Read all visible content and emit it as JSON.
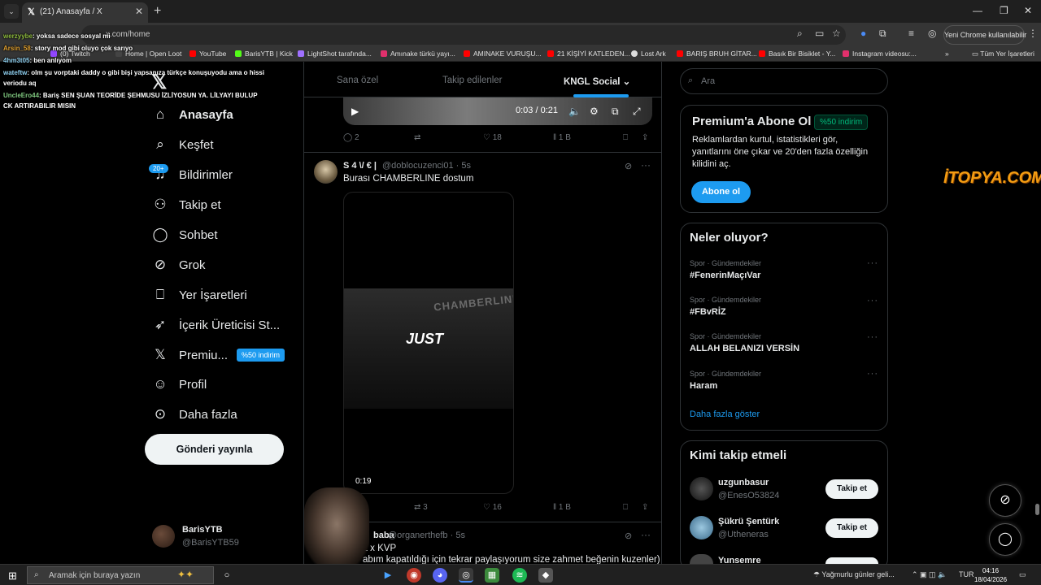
{
  "browser": {
    "tab_title": "(21) Anasayfa / X",
    "url": "x.com/home",
    "chrome_button": "Yeni Chrome kullanılabilir",
    "bookmarks": [
      {
        "label": "(0) Twitch",
        "color": "#9146ff"
      },
      {
        "label": "Home | Open Loot",
        "color": "#444444"
      },
      {
        "label": "YouTube",
        "color": "#ff0000"
      },
      {
        "label": "BarisYTB | Kick",
        "color": "#53fc18"
      },
      {
        "label": "LightShot tarafında...",
        "color": "#a070ff"
      },
      {
        "label": "Amınake türkü yayı...",
        "color": "#e1306c"
      },
      {
        "label": "AMINAKE VURUŞU...",
        "color": "#ff0000"
      },
      {
        "label": "21 KİŞİYİ KATLEDEN...",
        "color": "#ff0000"
      },
      {
        "label": "Lost Ark",
        "color": "#dddddd"
      },
      {
        "label": "BARIŞ BRUH GİTAR...",
        "color": "#ff0000"
      },
      {
        "label": "Basık Bir Bisiklet - Y...",
        "color": "#ff0000"
      },
      {
        "label": "Instagram videosu:...",
        "color": "#e1306c"
      }
    ],
    "all_bookmarks": "Tüm Yer İşaretleri"
  },
  "chat_overlay": [
    {
      "user": "werzyybe",
      "text": ": yoksa sadece sosyal mi"
    },
    {
      "user": "Arsin_58",
      "text": ": story mod gibi oluyo çok sarıyo"
    },
    {
      "user": "4hm3t05",
      "text": ": ben anlıyom"
    },
    {
      "user": "wateftw",
      "text": ": olm şu vorptaki daddy o gibi bişi yapsanıza türkçe konuşuyodu ama o hissi"
    },
    {
      "user": "",
      "text": "veriodu aq"
    },
    {
      "user": "UncleEro44",
      "text": ": Bariş SEN ŞUAN TEORİDE ŞEHMUSU İZLİYOSUN YA. LİLYAYI BULUP"
    },
    {
      "user": "",
      "text": "CK ARTIRABILIR MISIN"
    }
  ],
  "nav": {
    "items": [
      {
        "label": "Anasayfa",
        "icon": "home-icon"
      },
      {
        "label": "Keşfet",
        "icon": "search-icon"
      },
      {
        "label": "Bildirimler",
        "icon": "bell-icon"
      },
      {
        "label": "Takip et",
        "icon": "follow-icon"
      },
      {
        "label": "Sohbet",
        "icon": "chat-icon"
      },
      {
        "label": "Grok",
        "icon": "grok-icon"
      },
      {
        "label": "Yer İşaretleri",
        "icon": "bookmark-icon"
      },
      {
        "label": "İçerik Üreticisi St...",
        "icon": "rocket-icon"
      },
      {
        "label": "Premiu...",
        "icon": "x-icon"
      },
      {
        "label": "Profil",
        "icon": "person-icon"
      },
      {
        "label": "Daha fazla",
        "icon": "more-circle-icon"
      }
    ],
    "notif_badge": "20+",
    "premium_badge": "%50 indirim",
    "post_button": "Gönderi yayınla",
    "account_name": "BarisYTB",
    "account_handle": "@BarisYTB59"
  },
  "timeline": {
    "tabs": [
      "Sana özel",
      "Takip edilenler",
      "KNGL Social"
    ],
    "video1": {
      "time": "0:03 / 0:21",
      "replies": "2",
      "likes": "18",
      "views": "1 B"
    },
    "post1": {
      "name": "S 4 \\/ € |",
      "handle": "@doblocuzenci01 · 5s",
      "text": "Burası CHAMBERLINE dostum",
      "video_overlay": "JUST",
      "video_sign": "CHAMBERLINE",
      "duration": "0:19",
      "reposts": "3",
      "likes": "16",
      "views": "1 B"
    },
    "post2": {
      "name": "baba",
      "handle": "@organerthefb · 5s",
      "line1": "L x KVP",
      "line2": "abım kapatıldığı için tekrar paylaşıyorum size zahmet beğenin kuzenler)"
    }
  },
  "right": {
    "search_placeholder": "Ara",
    "premium": {
      "title": "Premium'a Abone Ol",
      "discount": "%50 indirim",
      "desc": "Reklamlardan kurtul, istatistikleri gör, yanıtlarını öne çıkar ve 20'den fazla özelliğin kilidini aç.",
      "button": "Abone ol"
    },
    "trends_title": "Neler oluyor?",
    "trends": [
      {
        "category": "Spor · Gündemdekiler",
        "name": "#FenerinMaçıVar"
      },
      {
        "category": "Spor · Gündemdekiler",
        "name": "#FBvRİZ"
      },
      {
        "category": "Spor · Gündemdekiler",
        "name": "ALLAH BELANIZI VERSİN"
      },
      {
        "category": "Spor · Gündemdekiler",
        "name": "Haram"
      }
    ],
    "show_more": "Daha fazla göster",
    "wtf_title": "Kimi takip etmeli",
    "wtf": [
      {
        "name": "uzgunbasur",
        "handle": "@EnesO53824",
        "button": "Takip et"
      },
      {
        "name": "Şükrü Şentürk",
        "handle": "@Utheneras",
        "button": "Takip et"
      },
      {
        "name": "Yunsemre",
        "handle": "",
        "button": ""
      }
    ]
  },
  "watermark": "İTOPYA.COM",
  "taskbar": {
    "search_placeholder": "Aramak için buraya yazın",
    "weather": "Yağmurlu günler geli...",
    "lang": "TUR",
    "time": "04:16",
    "date": "18/04/2026"
  }
}
